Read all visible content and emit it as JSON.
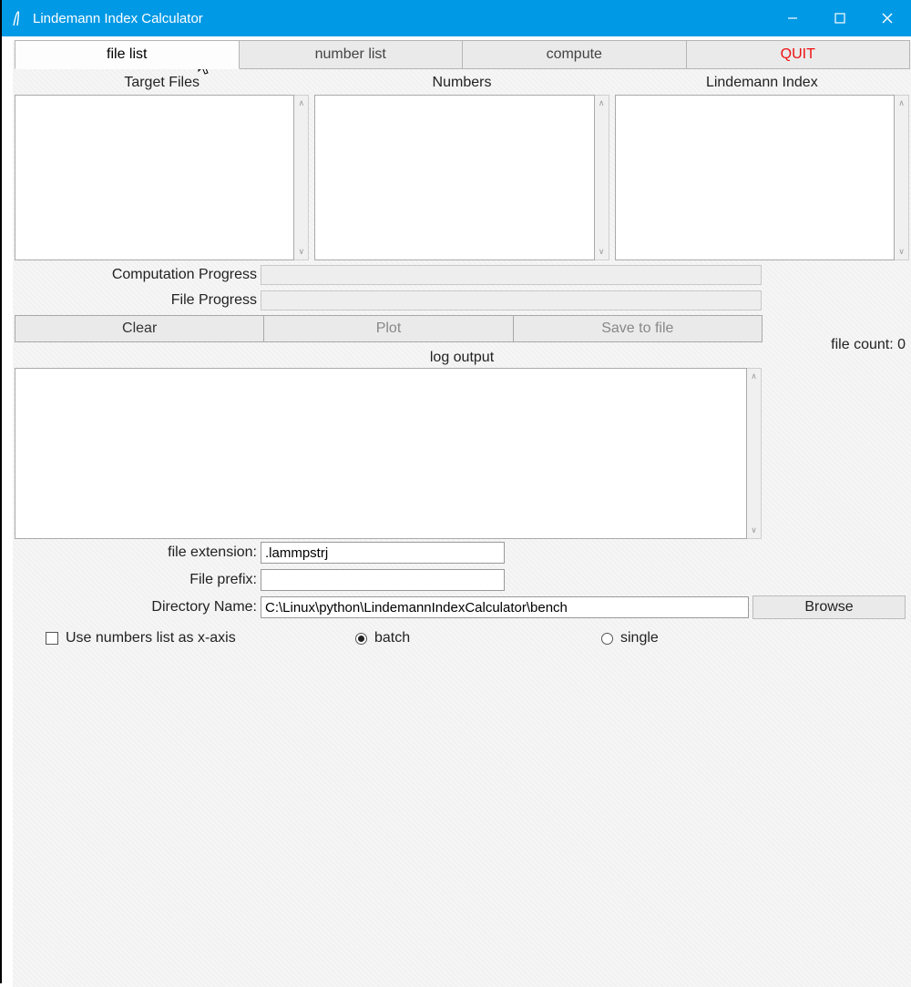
{
  "window": {
    "title": "Lindemann Index Calculator"
  },
  "tabs": {
    "file_list": "file list",
    "number_list": "number list",
    "compute": "compute",
    "quit": "QUIT"
  },
  "columns": {
    "target_files": "Target Files",
    "numbers": "Numbers",
    "lindemann_index": "Lindemann Index"
  },
  "progress": {
    "computation_label": "Computation Progress",
    "file_label": "File Progress",
    "file_count_text": "file count: 0"
  },
  "buttons": {
    "clear": "Clear",
    "plot": "Plot",
    "save_to_file": "Save to file",
    "browse": "Browse"
  },
  "log": {
    "label": "log output"
  },
  "form": {
    "file_extension_label": "file extension:",
    "file_extension_value": ".lammpstrj",
    "file_prefix_label": "File prefix:",
    "file_prefix_value": "",
    "directory_label": "Directory Name:",
    "directory_value": "C:\\Linux\\python\\LindemannIndexCalculator\\bench"
  },
  "options": {
    "use_numbers_xaxis": "Use numbers list as x-axis",
    "batch": "batch",
    "single": "single"
  }
}
